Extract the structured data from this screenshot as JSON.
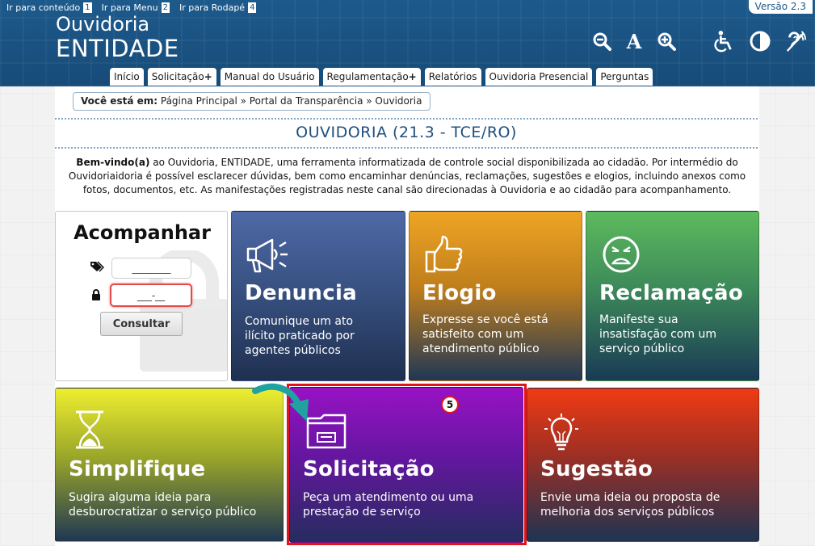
{
  "skip_links": [
    {
      "label": "Ir para conteúdo",
      "key": "1"
    },
    {
      "label": "Ir para Menu",
      "key": "2"
    },
    {
      "label": "Ir para Rodapé",
      "key": "4"
    }
  ],
  "version": "Versão 2.3",
  "brand": {
    "line1": "Ouvidoria",
    "line2": "ENTIDADE"
  },
  "toolbar_icons": [
    "zoom-out-icon",
    "font-size-icon",
    "zoom-in-icon",
    "accessibility-icon",
    "contrast-icon",
    "hearing-icon"
  ],
  "nav": [
    {
      "label": "Início"
    },
    {
      "label": "Solicitação",
      "suffix": "+"
    },
    {
      "label": "Manual do Usuário"
    },
    {
      "label": "Regulamentação",
      "suffix": "+"
    },
    {
      "label": "Relatórios"
    },
    {
      "label": "Ouvidoria Presencial"
    },
    {
      "label": "Perguntas"
    }
  ],
  "breadcrumb": {
    "prefix": "Você está em:",
    "path": "Página Principal » Portal da Transparência » Ouvidoria"
  },
  "page_title": "OUVIDORIA (21.3 - TCE/RO)",
  "intro": {
    "bold": "Bem-vindo(a)",
    "text": " ao Ouvidoria, ENTIDADE, uma ferramenta informatizada de controle social disponibilizada ao cidadão. Por intermédio do Ouvidoriaidoria é possível esclarecer dúvidas, bem como encaminhar denúncias, reclamações, sugestões e elogios, incluindo anexos como fotos, documentos, etc. As manifestações registradas neste canal são direcionadas à Ouvidoria e ao cidadão para acompanhamento."
  },
  "track": {
    "title": "Acompanhar",
    "protocol_placeholder": "________",
    "password_placeholder": "___-__",
    "button": "Consultar"
  },
  "tiles": {
    "denuncia": {
      "title": "Denuncia",
      "desc": [
        "Comunique um ato",
        "ilícito praticado por",
        "agentes públicos"
      ]
    },
    "elogio": {
      "title": "Elogio",
      "desc": [
        "Expresse se você está",
        "satisfeito com um",
        "atendimento público"
      ]
    },
    "reclamacao": {
      "title": "Reclamação",
      "desc": [
        "Manifeste sua",
        "insatisfação com um",
        "serviço público"
      ]
    },
    "simplifique": {
      "title": "Simplifique",
      "desc": [
        "Sugira alguma ideia para",
        "desburocratizar o serviço público"
      ]
    },
    "solicitacao": {
      "title": "Solicitação",
      "desc": [
        "Peça um atendimento ou uma",
        "prestação de serviço"
      ]
    },
    "sugestao": {
      "title": "Sugestão",
      "desc": [
        "Envie uma ideia ou proposta de",
        "melhoria dos serviços públicos"
      ]
    }
  },
  "step_badge": "5",
  "colors": {
    "header": "#1d5a8c",
    "highlight": "#e3121c",
    "arrow": "#1fa2a0"
  }
}
